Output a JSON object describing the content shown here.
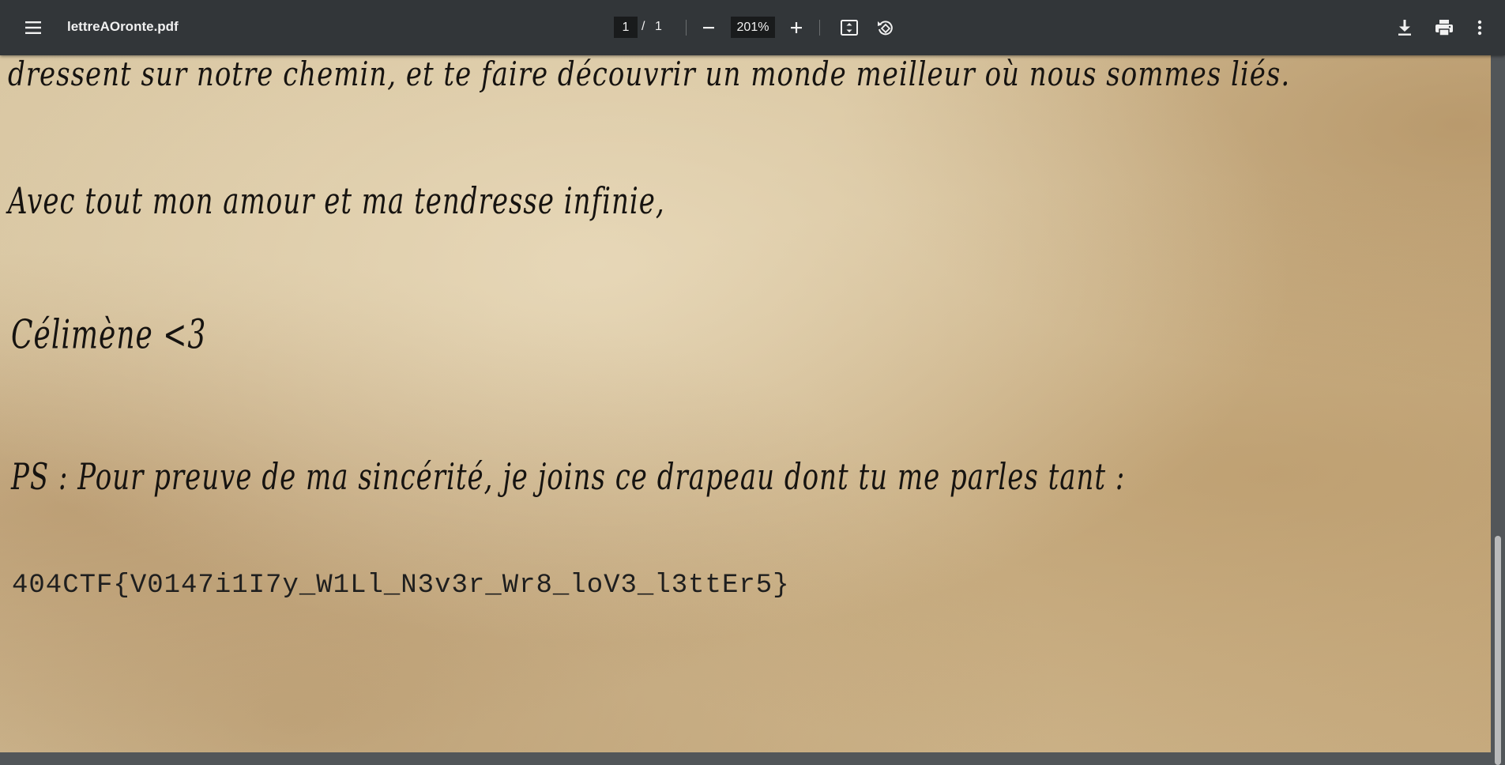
{
  "toolbar": {
    "menu_icon": "hamburger-menu-icon",
    "title": "lettreAOronte.pdf",
    "page_current": "1",
    "page_separator": "/",
    "page_total": "1",
    "zoom_out_icon": "minus-icon",
    "zoom_value": "201%",
    "zoom_in_icon": "plus-icon",
    "fit_icon": "fit-to-page-icon",
    "rotate_icon": "rotate-counterclockwise-icon",
    "download_icon": "download-icon",
    "print_icon": "print-icon",
    "more_icon": "more-vert-icon"
  },
  "document": {
    "lines": [
      "dressent sur notre chemin, et te faire découvrir un monde meilleur où nous sommes liés.",
      "Avec tout mon amour et ma tendresse infinie,",
      "Célimène <3",
      "PS : Pour preuve de ma sincérité, je joins ce drapeau dont tu me parles tant :"
    ],
    "flag": "404CTF{V0147i1I7y_W1Ll_N3v3r_Wr8_loV3_l3ttEr5}"
  },
  "colors": {
    "toolbar_bg": "#323639",
    "viewer_bg": "#525659",
    "paper": "#d6c29c",
    "ink": "#161310"
  }
}
